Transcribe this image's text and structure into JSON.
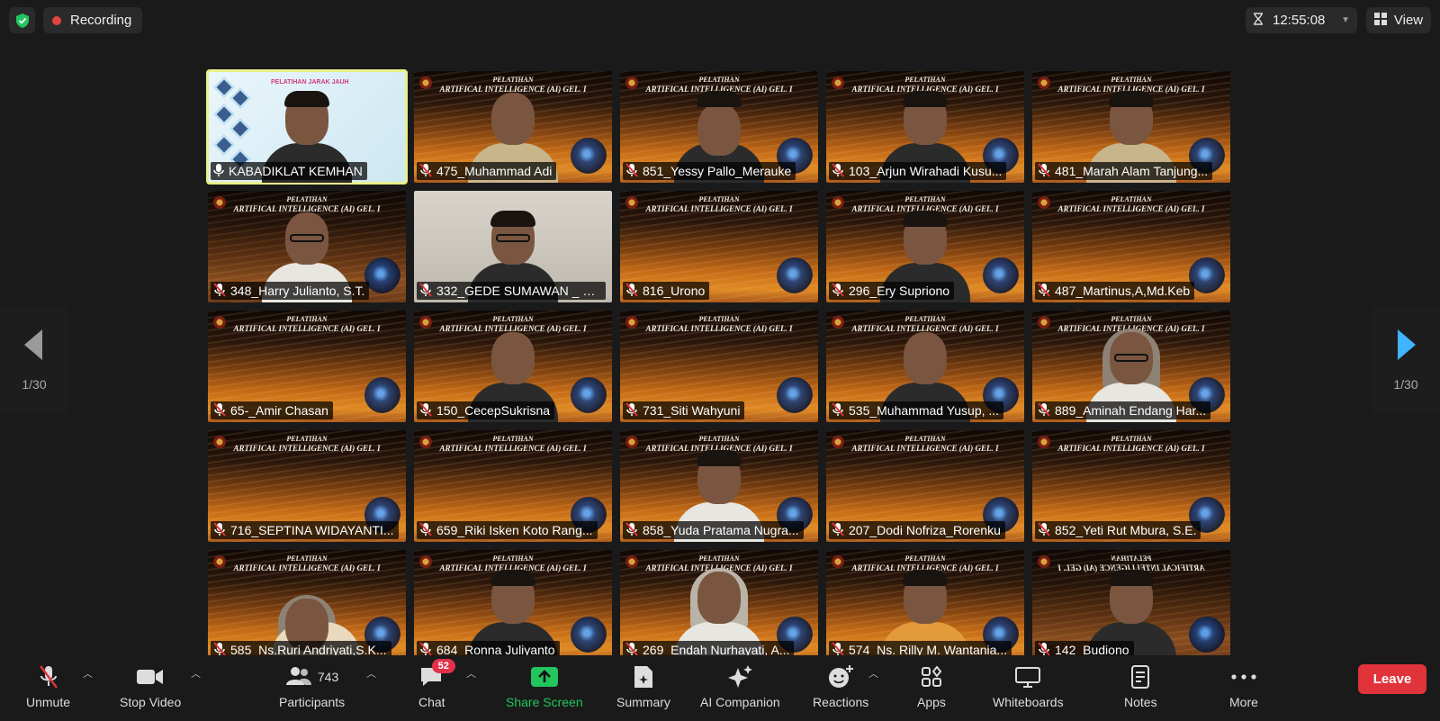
{
  "topbar": {
    "recording_label": "Recording",
    "timer": "12:55:08",
    "view_label": "View"
  },
  "pagination": {
    "left": "1/30",
    "right": "1/30"
  },
  "participants": [
    {
      "name": "KABADIKLAT KEMHAN",
      "muted": false,
      "host": true
    },
    {
      "name": "475_Muhammad Adi",
      "muted": true
    },
    {
      "name": "851_Yessy Pallo_Merauke",
      "muted": true
    },
    {
      "name": "103_Arjun Wirahadi Kusu...",
      "muted": true
    },
    {
      "name": "481_Marah Alam Tanjung...",
      "muted": true
    },
    {
      "name": "348_Harry Julianto, S.T.",
      "muted": true
    },
    {
      "name": "332_GEDE SUMAWAN _ D...",
      "muted": true
    },
    {
      "name": "816_Urono",
      "muted": true
    },
    {
      "name": "296_Ery Supriono",
      "muted": true
    },
    {
      "name": "487_Martinus,A,Md.Keb",
      "muted": true
    },
    {
      "name": "65-_Amir Chasan",
      "muted": true
    },
    {
      "name": "150_CecepSukrisna",
      "muted": true
    },
    {
      "name": "731_Siti Wahyuni",
      "muted": true
    },
    {
      "name": "535_Muhammad Yusup, ...",
      "muted": true
    },
    {
      "name": "889_Aminah Endang Har...",
      "muted": true
    },
    {
      "name": "716_SEPTINA WIDAYANTI...",
      "muted": true
    },
    {
      "name": "659_Riki Isken Koto Rang...",
      "muted": true
    },
    {
      "name": "858_Yuda Pratama Nugra...",
      "muted": true
    },
    {
      "name": "207_Dodi Nofriza_Rorenku",
      "muted": true
    },
    {
      "name": "852_Yeti Rut Mbura, S.E.",
      "muted": true
    },
    {
      "name": "585_Ns.Ruri Andriyati,S.K...",
      "muted": true
    },
    {
      "name": "684_Ronna Juliyanto",
      "muted": true
    },
    {
      "name": "269_Endah Nurhayati, A...",
      "muted": true
    },
    {
      "name": "574_Ns. Rilly M. Wantania...",
      "muted": true
    },
    {
      "name": "142_Budiono",
      "muted": true
    }
  ],
  "banner": {
    "line1": "PELATIHAN",
    "line2": "ARTIFICAL INTELLIGENCE (AI) GEL. I"
  },
  "host_slide": {
    "title": "PELATIHAN JARAK JAUH"
  },
  "toolbar": {
    "unmute": "Unmute",
    "stop_video": "Stop Video",
    "participants": "Participants",
    "participants_count": "743",
    "chat": "Chat",
    "chat_badge": "52",
    "share_screen": "Share Screen",
    "summary": "Summary",
    "ai_companion": "AI Companion",
    "reactions": "Reactions",
    "apps": "Apps",
    "whiteboards": "Whiteboards",
    "notes": "Notes",
    "more": "More",
    "leave": "Leave"
  },
  "colors": {
    "background": "#1a1a1a",
    "accent_green": "#22c55e",
    "leave_red": "#e0333a",
    "active_speaker": "#e9f08a",
    "badge_red": "#e0334a"
  }
}
